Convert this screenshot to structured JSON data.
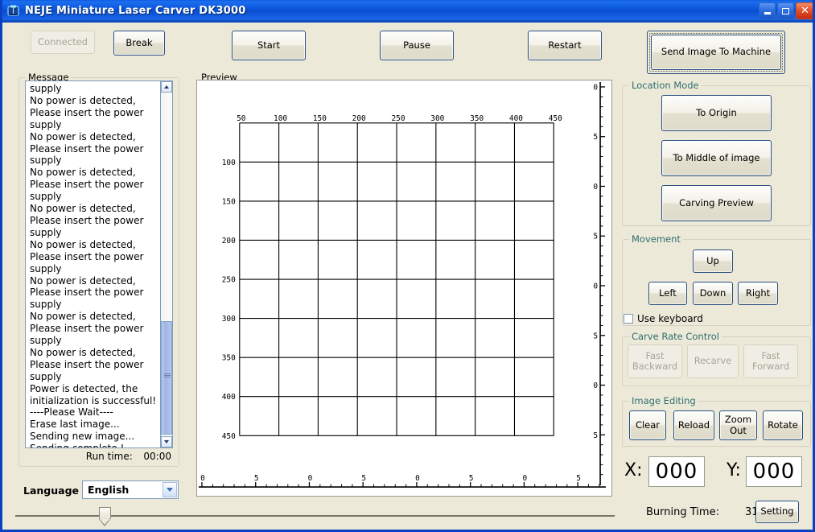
{
  "window": {
    "title": "NEJE Miniature Laser Carver DK3000",
    "icon": "laser-carver-icon",
    "minimize_label": "",
    "maximize_label": "",
    "close_label": "✕"
  },
  "toolbar": {
    "connected_label": "Connected",
    "break_label": "Break",
    "start_label": "Start",
    "pause_label": "Pause",
    "restart_label": "Restart"
  },
  "message_panel": {
    "group_label": "Message",
    "lines": [
      "supply",
      "No power is detected,",
      "Please insert the power",
      "supply",
      "No power is detected,",
      "Please insert the power",
      "supply",
      "No power is detected,",
      "Please insert the power",
      "supply",
      "No power is detected,",
      "Please insert the power",
      "supply",
      "No power is detected,",
      "Please insert the power",
      "supply",
      "No power is detected,",
      "Please insert the power",
      "supply",
      "No power is detected,",
      "Please insert the power",
      "supply",
      "No power is detected,",
      "Please insert the power",
      "supply",
      "Power is detected, the",
      "initialization is successful!",
      "----Please Wait----",
      "Erase last image...",
      "Sending new image...",
      "Sending complete !"
    ],
    "run_time_label": "Run time:",
    "run_time_value": "00:00"
  },
  "preview": {
    "group_label": "Preview"
  },
  "chart_data": {
    "type": "table",
    "title": "Preview",
    "xlabel": "",
    "ylabel": "",
    "grid": true,
    "cols": 8,
    "rows": 8,
    "x_ticks": [
      "50",
      "100",
      "150",
      "200",
      "250",
      "300",
      "350",
      "400",
      "450"
    ],
    "y_ticks": [
      "",
      "100",
      "150",
      "200",
      "250",
      "300",
      "350",
      "400",
      "450"
    ],
    "xlim": [
      50,
      450
    ],
    "ylim": [
      50,
      450
    ],
    "bottom_ruler_labels": [
      "0",
      "5",
      "0",
      "5",
      "0",
      "5",
      "0",
      "5"
    ],
    "right_ruler_labels": [
      "0",
      "5",
      "0",
      "5",
      "0",
      "5",
      "0",
      "5"
    ],
    "series": []
  },
  "right_panel": {
    "send_image_label": "Send Image To Machine",
    "location_mode": {
      "group_label": "Location Mode",
      "buttons": [
        "To Origin",
        "To Middle of image",
        "Carving Preview"
      ]
    },
    "movement": {
      "group_label": "Movement",
      "up_label": "Up",
      "left_label": "Left",
      "down_label": "Down",
      "right_label": "Right",
      "use_keyboard_label": "Use keyboard",
      "use_keyboard_checked": false
    },
    "carve_rate": {
      "group_label": "Carve Rate Control",
      "fast_backward_label": "Fast Backward",
      "recarve_label": "Recarve",
      "fast_forward_label": "Fast Forward"
    },
    "image_editing": {
      "group_label": "Image Editing",
      "buttons": [
        "Clear",
        "Reload",
        "Zoom Out",
        "Rotate"
      ]
    },
    "coords": {
      "x_label": "X:",
      "x_value": "000",
      "y_label": "Y:",
      "y_value": "000"
    },
    "burning_time_label": "Burning Time:",
    "burning_time_value": "31",
    "setting_label": "Setting"
  },
  "footer": {
    "language_label": "Language :",
    "language_value": "English",
    "language_options": [
      "English"
    ],
    "slider_value": 12
  },
  "colors": {
    "titlebar_blue": "#0a52d8",
    "window_border": "#0a41c4",
    "face": "#ece9d8",
    "group_label": "#2e6e6e",
    "button_border": "#2b4f81",
    "field_bg": "#ffffff",
    "close_red": "#c22b12"
  }
}
